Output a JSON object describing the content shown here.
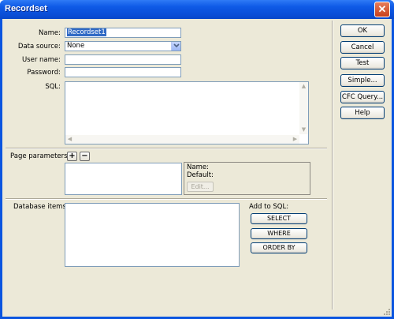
{
  "window": {
    "title": "Recordset",
    "close_glyph": "✕"
  },
  "form": {
    "name_label": "Name:",
    "name_value": "Recordset1",
    "datasource_label": "Data source:",
    "datasource_value": "None",
    "username_label": "User name:",
    "username_value": "",
    "password_label": "Password:",
    "password_value": "",
    "sql_label": "SQL:",
    "sql_value": ""
  },
  "buttons": {
    "ok": "OK",
    "cancel": "Cancel",
    "test": "Test",
    "simple": "Simple...",
    "cfc_query": "CFC Query...",
    "help": "Help"
  },
  "page_parameters": {
    "label": "Page parameters:",
    "add_glyph": "+",
    "remove_glyph": "−",
    "name_label": "Name:",
    "default_label": "Default:",
    "edit_button": "Edit..."
  },
  "database_items": {
    "label": "Database items:",
    "add_to_sql_label": "Add to SQL:",
    "select_button": "SELECT",
    "where_button": "WHERE",
    "order_by_button": "ORDER BY"
  },
  "icons": {
    "close": "close-icon",
    "dropdown": "chevron-down-icon",
    "resize": "resize-grip-icon"
  },
  "colors": {
    "title_bar": "#0a4fd8",
    "dialog_bg": "#ece9d8",
    "selection": "#316ac5",
    "close_button": "#c9401c"
  }
}
